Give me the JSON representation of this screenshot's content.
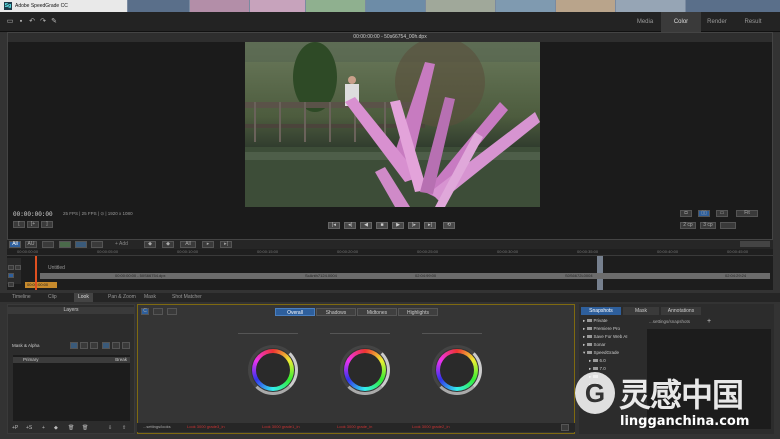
{
  "browser_tabs": {
    "app_title": "Adobe SpeedGrade CC",
    "logo_text": "Sg",
    "other": [
      "",
      "",
      "",
      "",
      "",
      "",
      "",
      "",
      ""
    ]
  },
  "toolbar": {
    "nav": [
      "Media",
      "Color",
      "Render",
      "Result"
    ],
    "active": "Color"
  },
  "viewer": {
    "header": "00:00:00:00 - 50s66754_00h.dpx",
    "timecode": "00:00:00:00",
    "info": "25 FPS | 25 FPS | ⊙ | 1920 x 1080",
    "fit_label": "Fit",
    "copy_labels": [
      "2 cp",
      "3 cp"
    ]
  },
  "timeline": {
    "toolbar_labels": [
      "All",
      "AU",
      "",
      "+ Add",
      "All"
    ],
    "ruler_ticks": [
      "00:00:00:00",
      "00:00:05:00",
      "00:00:10:00",
      "00:00:15:00",
      "00:00:20:00",
      "00:00:25:00",
      "00:00:30:00",
      "00:00:35:00",
      "00:00:40:00",
      "00:00:45:00"
    ],
    "track_name": "Untitled",
    "clip_labels": [
      "00:00:00:00 - 50S66754.dpx",
      "ScAnth7124.0004",
      "02:04:99:00",
      "S0S6672L0004",
      "02:04:29:24"
    ],
    "track_tc": "00:00:00:00"
  },
  "bottom_tabs": [
    "Timeline",
    "Clip",
    "Look",
    "Pan & Zoom",
    "Mask",
    "Shot Matcher"
  ],
  "bottom_tabs_active": "Look",
  "layers": {
    "title": "Layers",
    "mask_label": "Mask & Alpha",
    "primary": "Primary",
    "primary_right": "Break"
  },
  "color": {
    "tabs": [
      "Overall",
      "Shadows",
      "Midtones",
      "Highlights"
    ],
    "active_tab": "Overall"
  },
  "snapshots": {
    "tabs": [
      "Snapshots",
      "Mask",
      "Annotations"
    ],
    "active_tab": "Snapshots",
    "folder_path": "...settings/snapshots",
    "tree": [
      "Private",
      "Premiere Pro",
      "Save For Web AI",
      "Sonar",
      "SpeedGrade",
      "6.0",
      "7.0",
      "",
      ""
    ]
  },
  "bottom_strip": {
    "first": "...settings/looks",
    "items": [
      "Look 3000 grade3_in",
      "Look 3000 grade1_in",
      "Look 3000 grade_in",
      "Look 3000 grade2_in"
    ]
  },
  "watermark": {
    "logo": "G",
    "text": "灵感中国",
    "url": "lingganchina.com"
  },
  "colors": {
    "accent": "#2e5f9c",
    "panel_border": "#7f6a10",
    "playhead": "#e05020"
  }
}
